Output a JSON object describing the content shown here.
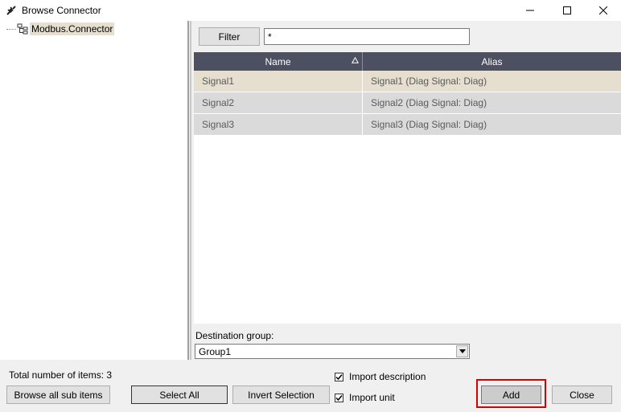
{
  "window": {
    "title": "Browse Connector",
    "icon": "connector-plug-icon"
  },
  "tree": {
    "root_label": "Modbus.Connector"
  },
  "filter": {
    "button_label": "Filter",
    "value": "*"
  },
  "grid": {
    "columns": [
      "Name",
      "Alias"
    ],
    "sort_column": "Name",
    "rows": [
      {
        "name": "Signal1",
        "alias": "Signal1 (Diag Signal: Diag)",
        "selected": true
      },
      {
        "name": "Signal2",
        "alias": "Signal2 (Diag Signal: Diag)",
        "selected": false
      },
      {
        "name": "Signal3",
        "alias": "Signal3 (Diag Signal: Diag)",
        "selected": false
      }
    ]
  },
  "destination": {
    "label": "Destination group:",
    "value": "Group1"
  },
  "footer": {
    "total_label": "Total number of items: 3",
    "browse_all_label": "Browse all sub items",
    "select_all_label": "Select All",
    "invert_selection_label": "Invert Selection",
    "import_description_label": "Import description",
    "import_description_checked": true,
    "import_unit_label": "Import unit",
    "import_unit_checked": true,
    "add_label": "Add",
    "close_label": "Close"
  },
  "colors": {
    "header_bg": "#4c5060",
    "selected_row": "#e6dfcf",
    "highlight": "#d60000"
  }
}
